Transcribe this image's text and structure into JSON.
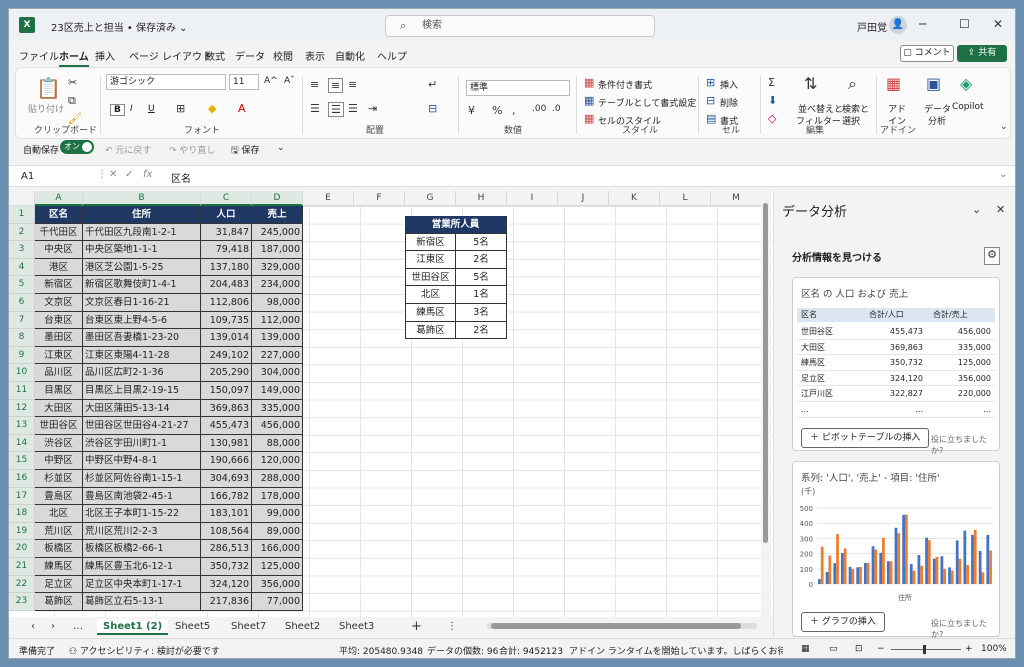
{
  "window": {
    "file_title": "23区売上と担当 • 保存済み ⌄",
    "search_placeholder": "検索",
    "user_name": "戸田覚",
    "minimize": "─",
    "maximize": "☐",
    "close": "✕"
  },
  "menu": [
    "ファイル",
    "ホーム",
    "挿入",
    "ページ レイアウト",
    "数式",
    "データ",
    "校閲",
    "表示",
    "自動化",
    "ヘルプ"
  ],
  "comment_btn": "コメント",
  "share_btn": "共有",
  "ribbon": {
    "clipboard": {
      "paste": "貼り付け",
      "group": "クリップボード"
    },
    "font": {
      "name": "游ゴシック",
      "size": "11",
      "bold": "B",
      "italic": "I",
      "underline": "U",
      "grow": "A^",
      "shrink": "Aˇ",
      "group": "フォント"
    },
    "align": {
      "group": "配置"
    },
    "number": {
      "format": "標準",
      "group": "数値"
    },
    "styles": {
      "cond": "条件付き書式",
      "table": "テーブルとして書式設定",
      "cell": "セルのスタイル",
      "group": "スタイル"
    },
    "cells": {
      "insert": "挿入",
      "delete": "削除",
      "format": "書式",
      "group": "セル"
    },
    "edit": {
      "sort": "並べ替えと",
      "sort2": "フィルター",
      "find": "検索と",
      "find2": "選択",
      "group": "編集"
    },
    "addin": {
      "label": "アド",
      "label2": "イン",
      "group": "アドイン"
    },
    "data_analysis": {
      "label": "データ",
      "label2": "分析"
    },
    "copilot": "Copilot"
  },
  "qat": {
    "autosave": "自動保存",
    "toggle": "オン",
    "undo": "元に戻す",
    "redo": "やり直し",
    "save": "保存"
  },
  "formula": {
    "cell_ref": "A1",
    "fx": "fx",
    "value": "区名"
  },
  "columns": [
    "A",
    "B",
    "C",
    "D",
    "E",
    "F",
    "G",
    "H",
    "I",
    "J",
    "K",
    "L",
    "M"
  ],
  "table": {
    "headers": [
      "区名",
      "住所",
      "人口",
      "売上"
    ],
    "rows": [
      [
        "千代田区",
        "千代田区九段南1-2-1",
        "31,847",
        "245,000"
      ],
      [
        "中央区",
        "中央区築地1-1-1",
        "79,418",
        "187,000"
      ],
      [
        "港区",
        "港区芝公園1-5-25",
        "137,180",
        "329,000"
      ],
      [
        "新宿区",
        "新宿区歌舞伎町1-4-1",
        "204,483",
        "234,000"
      ],
      [
        "文京区",
        "文京区春日1-16-21",
        "112,806",
        "98,000"
      ],
      [
        "台東区",
        "台東区東上野4-5-6",
        "109,735",
        "112,000"
      ],
      [
        "墨田区",
        "墨田区吾妻橋1-23-20",
        "139,014",
        "139,000"
      ],
      [
        "江東区",
        "江東区東陽4-11-28",
        "249,102",
        "227,000"
      ],
      [
        "品川区",
        "品川区広町2-1-36",
        "205,290",
        "304,000"
      ],
      [
        "目黒区",
        "目黒区上目黒2-19-15",
        "150,097",
        "149,000"
      ],
      [
        "大田区",
        "大田区蒲田5-13-14",
        "369,863",
        "335,000"
      ],
      [
        "世田谷区",
        "世田谷区世田谷4-21-27",
        "455,473",
        "456,000"
      ],
      [
        "渋谷区",
        "渋谷区宇田川町1-1",
        "130,981",
        "88,000"
      ],
      [
        "中野区",
        "中野区中野4-8-1",
        "190,666",
        "120,000"
      ],
      [
        "杉並区",
        "杉並区阿佐谷南1-15-1",
        "304,693",
        "288,000"
      ],
      [
        "豊島区",
        "豊島区南池袋2-45-1",
        "166,782",
        "178,000"
      ],
      [
        "北区",
        "北区王子本町1-15-22",
        "183,101",
        "99,000"
      ],
      [
        "荒川区",
        "荒川区荒川2-2-3",
        "108,564",
        "89,000"
      ],
      [
        "板橋区",
        "板橋区板橋2-66-1",
        "286,513",
        "166,000"
      ],
      [
        "練馬区",
        "練馬区豊玉北6-12-1",
        "350,732",
        "125,000"
      ],
      [
        "足立区",
        "足立区中央本町1-17-1",
        "324,120",
        "356,000"
      ],
      [
        "葛飾区",
        "葛飾区立石5-13-1",
        "217,836",
        "77,000"
      ]
    ]
  },
  "staff": {
    "title": "営業所人員",
    "rows": [
      [
        "新宿区",
        "5名"
      ],
      [
        "江東区",
        "2名"
      ],
      [
        "世田谷区",
        "5名"
      ],
      [
        "北区",
        "1名"
      ],
      [
        "練馬区",
        "3名"
      ],
      [
        "葛飾区",
        "2名"
      ]
    ]
  },
  "sheet_tabs": [
    "Sheet1 (2)",
    "Sheet5",
    "Sheet7",
    "Sheet2",
    "Sheet3"
  ],
  "status": {
    "ready": "準備完了",
    "access": "アクセシビリティ: 検討が必要です",
    "avg": "平均: 205480.9348",
    "count": "データの個数: 96",
    "sum": "合計: 9452123",
    "addin_msg": "アドイン ランタイムを開始しています。しばらくお待ちください...",
    "zoom": "100%"
  },
  "panel": {
    "title": "データ分析",
    "subtitle": "分析情報を見つける",
    "card1": {
      "title": "区名 の 人口 および 売上",
      "headers": [
        "区名",
        "合計/人口",
        "合計/売上"
      ],
      "rows": [
        [
          "世田谷区",
          "455,473",
          "456,000"
        ],
        [
          "大田区",
          "369,863",
          "335,000"
        ],
        [
          "練馬区",
          "350,732",
          "125,000"
        ],
        [
          "足立区",
          "324,120",
          "356,000"
        ],
        [
          "江戸川区",
          "322,827",
          "220,000"
        ],
        [
          "...",
          "...",
          "..."
        ]
      ],
      "button": "ピボットテーブルの挿入",
      "help": "役に立ちましたか?"
    },
    "card2": {
      "title": "系列: '人口', '売上' - 項目: '住所'",
      "unit": "(千)",
      "xlabel": "住所",
      "button": "グラフの挿入",
      "help": "役に立ちましたか?"
    }
  },
  "chart_data": {
    "type": "bar",
    "title": "系列: '人口', '売上' - 項目: '住所'",
    "ylabel": "(千)",
    "xlabel": "住所",
    "ylim": [
      0,
      500
    ],
    "yticks": [
      "500",
      "400",
      "300",
      "200",
      "100",
      "0"
    ],
    "series": [
      {
        "name": "人口",
        "color": "#4472c4",
        "values": [
          32,
          79,
          137,
          204,
          113,
          110,
          139,
          249,
          205,
          150,
          370,
          455,
          131,
          191,
          305,
          167,
          183,
          109,
          287,
          351,
          324,
          218,
          323
        ]
      },
      {
        "name": "売上",
        "color": "#ed7d31",
        "values": [
          245,
          187,
          329,
          234,
          98,
          112,
          139,
          227,
          304,
          149,
          335,
          456,
          88,
          120,
          288,
          178,
          99,
          89,
          166,
          125,
          356,
          77,
          220
        ]
      }
    ]
  }
}
